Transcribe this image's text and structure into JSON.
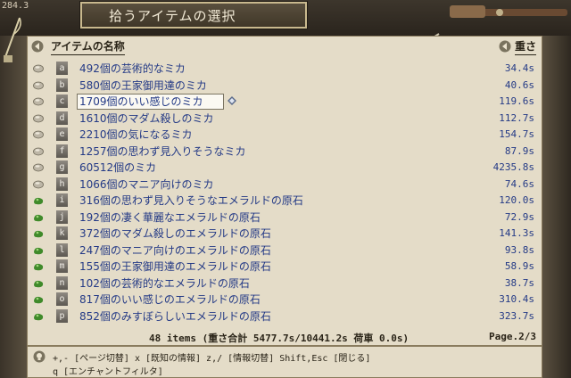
{
  "window": {
    "title": "拾うアイテムの選択",
    "corner_tag": "284.3"
  },
  "header": {
    "name_label": "アイテムの名称",
    "weight_label": "重さ"
  },
  "items": [
    {
      "key": "a",
      "name": "492個の芸術的なミカ",
      "weight": "34.4s",
      "icon": "stone-icon"
    },
    {
      "key": "b",
      "name": "580個の王家御用達のミカ",
      "weight": "40.6s",
      "icon": "stone-icon"
    },
    {
      "key": "c",
      "name": "1709個のいい感じのミカ",
      "weight": "119.6s",
      "icon": "stone-icon"
    },
    {
      "key": "d",
      "name": "1610個のマダム殺しのミカ",
      "weight": "112.7s",
      "icon": "stone-icon"
    },
    {
      "key": "e",
      "name": "2210個の気になるミカ",
      "weight": "154.7s",
      "icon": "stone-icon"
    },
    {
      "key": "f",
      "name": "1257個の思わず見入りそうなミカ",
      "weight": "87.9s",
      "icon": "stone-icon"
    },
    {
      "key": "g",
      "name": "60512個のミカ",
      "weight": "4235.8s",
      "icon": "stone-icon"
    },
    {
      "key": "h",
      "name": "1066個のマニア向けのミカ",
      "weight": "74.6s",
      "icon": "stone-icon"
    },
    {
      "key": "i",
      "name": "316個の思わず見入りそうなエメラルドの原石",
      "weight": "120.0s",
      "icon": "emerald-icon"
    },
    {
      "key": "j",
      "name": "192個の凄く華麗なエメラルドの原石",
      "weight": "72.9s",
      "icon": "emerald-icon"
    },
    {
      "key": "k",
      "name": "372個のマダム殺しのエメラルドの原石",
      "weight": "141.3s",
      "icon": "emerald-icon"
    },
    {
      "key": "l",
      "name": "247個のマニア向けのエメラルドの原石",
      "weight": "93.8s",
      "icon": "emerald-icon"
    },
    {
      "key": "m",
      "name": "155個の王家御用達のエメラルドの原石",
      "weight": "58.9s",
      "icon": "emerald-icon"
    },
    {
      "key": "n",
      "name": "102個の芸術的なエメラルドの原石",
      "weight": "38.7s",
      "icon": "emerald-icon"
    },
    {
      "key": "o",
      "name": "817個のいい感じのエメラルドの原石",
      "weight": "310.4s",
      "icon": "emerald-icon"
    },
    {
      "key": "p",
      "name": "852個のみすぼらしいエメラルドの原石",
      "weight": "323.7s",
      "icon": "emerald-icon"
    }
  ],
  "selected_index": 2,
  "footer": {
    "stats": "48 items  (重さ合計 5477.7s/10441.2s  荷車 0.0s)",
    "page": "Page.2/3"
  },
  "help": {
    "line1": "+,- [ページ切替]  x [既知の情報]  z,/ [情報切替]  Shift,Esc [閉じる]",
    "line2": "q [エンチャントフィルタ]"
  },
  "colors": {
    "item_text": "#243a86",
    "panel_bg": "#e4dcc8",
    "emerald": "#3f8a2a",
    "stone": "#bdb6a6"
  }
}
